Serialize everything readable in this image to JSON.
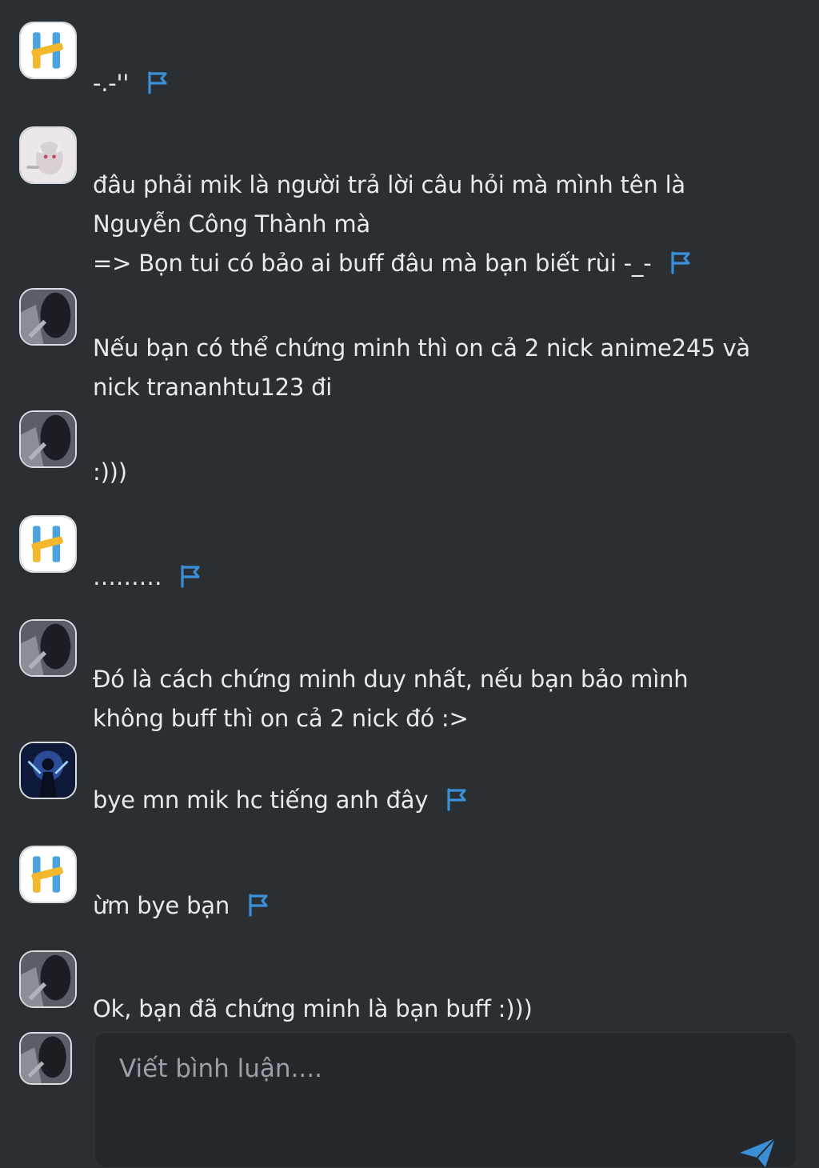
{
  "colors": {
    "background": "#2a2f34",
    "text": "#e8eaec",
    "flag": "#3a8fd6",
    "placeholder": "#9aa0a6",
    "composer_bg": "#24282c"
  },
  "comments": [
    {
      "avatar": "hoc24-logo-avatar",
      "text": "-.-''",
      "has_flag": true
    },
    {
      "avatar": "fox-mask-avatar",
      "text": "đâu phải mik là người trả lời câu hỏi mà mình tên là\nNguyễn Công Thành mà\n=> Bọn tui có bảo ai buff đâu mà bạn biết rùi -_-",
      "has_flag": true
    },
    {
      "avatar": "dark-portrait-avatar",
      "text": "Nếu bạn có thể chứng minh thì on cả 2 nick anime245 và\nnick trananhtu123 đi",
      "has_flag": false
    },
    {
      "avatar": "dark-portrait-avatar",
      "text": ":)))",
      "has_flag": false
    },
    {
      "avatar": "hoc24-logo-avatar",
      "text": "………",
      "has_flag": true
    },
    {
      "avatar": "dark-portrait-avatar",
      "text": "Đó là cách chứng minh duy nhất, nếu bạn bảo mình\nkhông buff thì on cả 2 nick đó :>",
      "has_flag": false
    },
    {
      "avatar": "neon-figure-avatar",
      "text": "bye mn mik hc tiếng anh đây",
      "has_flag": true
    },
    {
      "avatar": "hoc24-logo-avatar",
      "text": "ừm bye bạn",
      "has_flag": true
    },
    {
      "avatar": "dark-portrait-avatar",
      "text": "Ok, bạn đã chứng minh là bạn buff :)))",
      "has_flag": false
    }
  ],
  "composer": {
    "placeholder": "Viết bình luận....",
    "value": "",
    "avatar": "dark-portrait-avatar",
    "send_icon": "send-icon"
  }
}
